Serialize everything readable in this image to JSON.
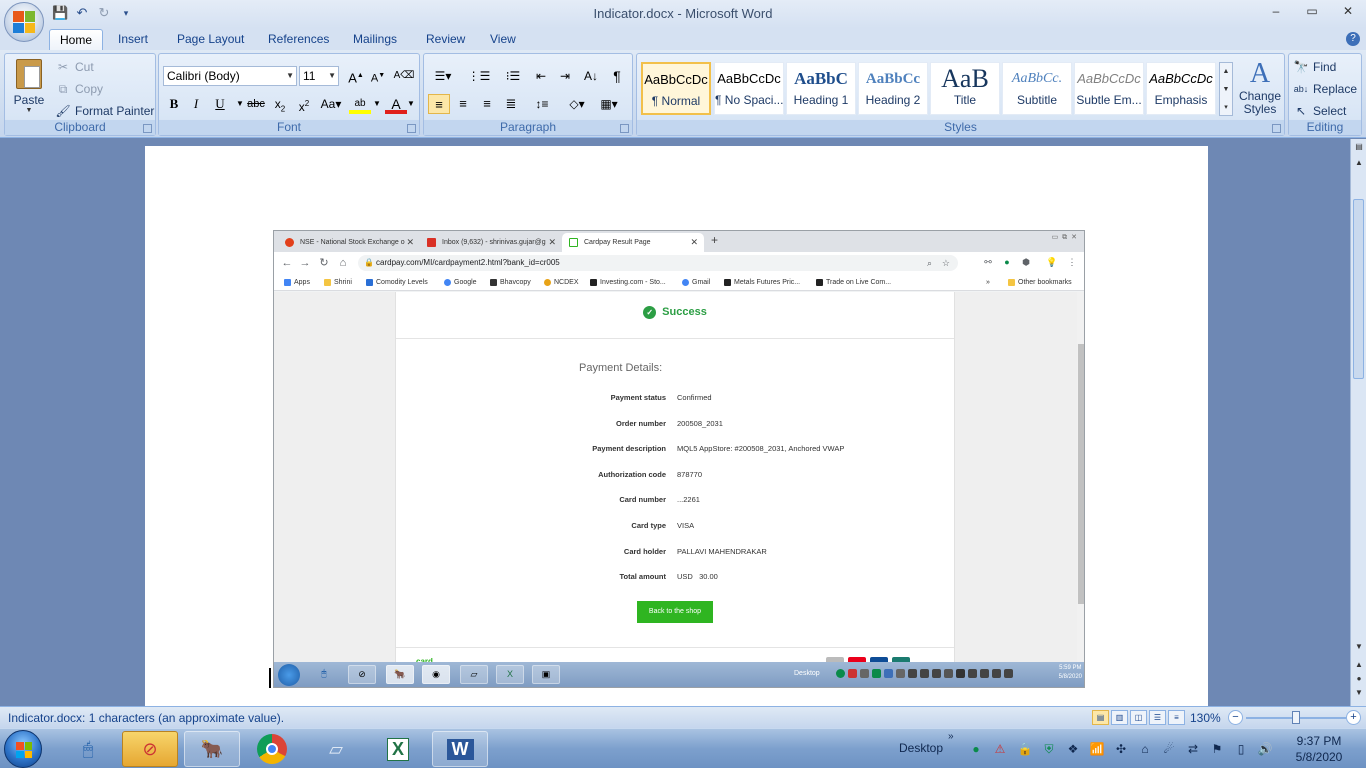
{
  "window": {
    "title": "Indicator.docx - Microsoft Word",
    "minimize": "–",
    "maximize": "▭",
    "close": "✕"
  },
  "ribbon": {
    "tabs": [
      "Home",
      "Insert",
      "Page Layout",
      "References",
      "Mailings",
      "Review",
      "View"
    ],
    "active_tab": "Home",
    "clipboard": {
      "label": "Clipboard",
      "paste": "Paste",
      "cut": "Cut",
      "copy": "Copy",
      "format_painter": "Format Painter"
    },
    "font": {
      "label": "Font",
      "family": "Calibri (Body)",
      "size": "11"
    },
    "paragraph": {
      "label": "Paragraph"
    },
    "styles": {
      "label": "Styles",
      "items": [
        {
          "sample": "AaBbCcDc",
          "name": "¶ Normal"
        },
        {
          "sample": "AaBbCcDc",
          "name": "¶ No Spaci..."
        },
        {
          "sample": "AaBbC",
          "name": "Heading 1"
        },
        {
          "sample": "AaBbCc",
          "name": "Heading 2"
        },
        {
          "sample": "AaB",
          "name": "Title"
        },
        {
          "sample": "AaBbCc.",
          "name": "Subtitle"
        },
        {
          "sample": "AaBbCcDc",
          "name": "Subtle Em..."
        },
        {
          "sample": "AaBbCcDc",
          "name": "Emphasis"
        }
      ],
      "change_styles": "Change Styles"
    },
    "editing": {
      "label": "Editing",
      "find": "Find",
      "replace": "Replace",
      "select": "Select"
    }
  },
  "browser": {
    "tabs": [
      {
        "title": "NSE - National Stock Exchange o",
        "color": "#e2401b"
      },
      {
        "title": "Inbox (9,632) - shrinivas.gujar@g",
        "color": "#d93025"
      },
      {
        "title": "Cardpay Result Page",
        "color": "#2fb521"
      }
    ],
    "url": "cardpay.com/MI/cardpayment2.html?bank_id=cr005",
    "bookmarks": [
      {
        "label": "Apps",
        "color": "#4285f4"
      },
      {
        "label": "Shrini",
        "color": "#f4c542"
      },
      {
        "label": "Comodity Levels",
        "color": "#2a6fd6"
      },
      {
        "label": "Google",
        "color": "#4285f4"
      },
      {
        "label": "Bhavcopy",
        "color": "#333333"
      },
      {
        "label": "NCDEX",
        "color": "#e8a317"
      },
      {
        "label": "Investing.com - Sto...",
        "color": "#222222"
      },
      {
        "label": "Gmail",
        "color": "#4285f4"
      },
      {
        "label": "Metals Futures Pric...",
        "color": "#222222"
      },
      {
        "label": "Trade on Live Com...",
        "color": "#222222"
      }
    ],
    "bookmarks_more": "»",
    "other_bookmarks": "Other bookmarks",
    "page": {
      "success": "Success",
      "details_title": "Payment Details:",
      "rows": [
        {
          "label": "Payment status",
          "value": "Confirmed"
        },
        {
          "label": "Order number",
          "value": "200508_2031"
        },
        {
          "label": "Payment description",
          "value": "MQL5 AppStore: #200508_2031, Anchored VWAP"
        },
        {
          "label": "Authorization code",
          "value": "878770"
        },
        {
          "label": "Card number",
          "value": "...2261"
        },
        {
          "label": "Card type",
          "value": "VISA"
        },
        {
          "label": "Card holder",
          "value": "PALLAVI MAHENDRAKAR"
        },
        {
          "label": "Total amount",
          "value": "USD   30.00"
        }
      ],
      "back_button": "Back to the shop",
      "footer_logo": "card"
    },
    "taskbar": {
      "desktop": "Desktop",
      "time": "5:59 PM",
      "date": "5/8/2020"
    }
  },
  "statusbar": {
    "text": "Indicator.docx: 1 characters (an approximate value).",
    "zoom": "130%",
    "zoom_level_percent": 130
  },
  "taskbar": {
    "desktop": "Desktop",
    "chevron": "»",
    "time": "9:37 PM",
    "date": "5/8/2020"
  }
}
